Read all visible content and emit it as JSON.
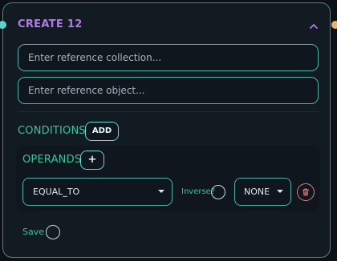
{
  "node": {
    "title": "CREATE 12",
    "inputs": {
      "collection_placeholder": "Enter reference collection...",
      "object_placeholder": "Enter reference object..."
    },
    "conditions": {
      "label": "CONDITIONS",
      "add_label": "ADD"
    },
    "operands": {
      "label": "OPERANDS",
      "plus_label": "+"
    },
    "operator_select": {
      "value": "EQUAL_TO"
    },
    "inverse_label": "Inverse?",
    "none_select": {
      "value": "NONE"
    },
    "save_label": "Save"
  },
  "icons": {
    "chevron": "chevron-up-icon",
    "caret": "caret-down-icon",
    "trash": "trash-icon"
  },
  "colors": {
    "title": "#b07ae8",
    "label_green": "#39c49a",
    "border_teal": "#4fb1a6",
    "handle_left": "#5ad3cf",
    "handle_right": "#e8b56a",
    "danger": "#e07d7d"
  }
}
